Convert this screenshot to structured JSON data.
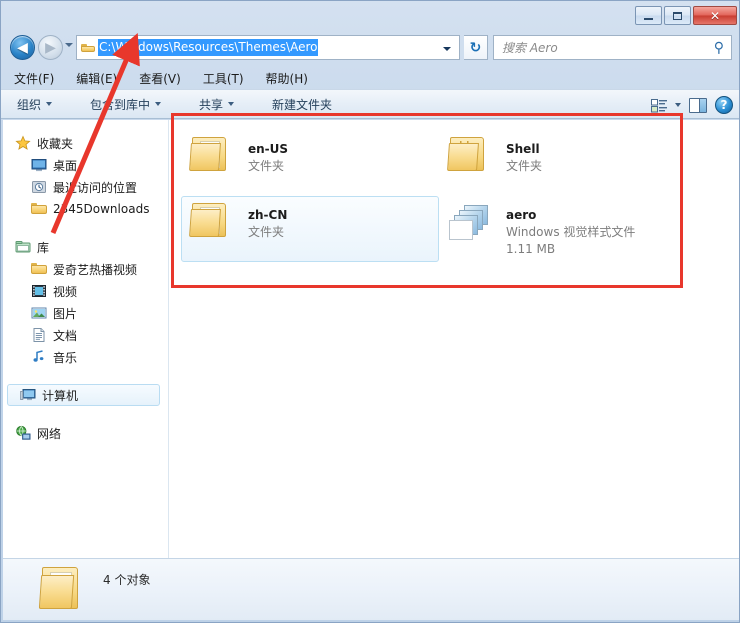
{
  "window": {
    "buttons": {
      "minimize_label": "–",
      "maximize_label": "",
      "close_label": "✕"
    }
  },
  "address_bar": {
    "back_glyph": "◀",
    "forward_glyph": "▶",
    "path": "C:\\Windows\\Resources\\Themes\\Aero",
    "refresh_glyph": "↻",
    "search_placeholder": "搜索 Aero",
    "search_icon_glyph": "⚲"
  },
  "menu": {
    "items": [
      {
        "label": "文件(F)"
      },
      {
        "label": "编辑(E)"
      },
      {
        "label": "查看(V)"
      },
      {
        "label": "工具(T)"
      },
      {
        "label": "帮助(H)"
      }
    ]
  },
  "toolbar": {
    "items": [
      {
        "label": "组织",
        "caret": true
      },
      {
        "label": "包含到库中",
        "caret": true
      },
      {
        "label": "共享",
        "caret": true
      },
      {
        "label": "新建文件夹",
        "caret": false
      }
    ],
    "help_label": "?"
  },
  "sidebar": {
    "groups": [
      {
        "header": {
          "label": "收藏夹",
          "icon": "star-icon"
        },
        "items": [
          {
            "label": "桌面",
            "icon": "desktop-icon"
          },
          {
            "label": "最近访问的位置",
            "icon": "recent-places-icon"
          },
          {
            "label": "2345Downloads",
            "icon": "folder-icon"
          }
        ]
      },
      {
        "header": {
          "label": "库",
          "icon": "library-icon"
        },
        "items": [
          {
            "label": "爱奇艺热播视频",
            "icon": "folder-icon"
          },
          {
            "label": "视频",
            "icon": "video-icon"
          },
          {
            "label": "图片",
            "icon": "pictures-icon"
          },
          {
            "label": "文档",
            "icon": "documents-icon"
          },
          {
            "label": "音乐",
            "icon": "music-icon"
          }
        ]
      },
      {
        "header": {
          "label": "计算机",
          "icon": "computer-icon",
          "hovered": true
        },
        "items": []
      },
      {
        "header": {
          "label": "网络",
          "icon": "network-icon"
        },
        "items": []
      }
    ]
  },
  "files": [
    {
      "name": "en-US",
      "type": "文件夹",
      "size": "",
      "icon": "folder-icon",
      "hovered": false
    },
    {
      "name": "Shell",
      "type": "文件夹",
      "size": "",
      "icon": "folder-multi-icon",
      "hovered": false
    },
    {
      "name": "zh-CN",
      "type": "文件夹",
      "size": "",
      "icon": "folder-icon",
      "hovered": true
    },
    {
      "name": "aero",
      "type": "Windows 视觉样式文件",
      "size": "1.11 MB",
      "icon": "theme-file-icon",
      "hovered": false
    }
  ],
  "status_bar": {
    "text": "4 个对象",
    "icon": "folder-icon"
  },
  "annotations": {
    "highlight_color": "#e8372c",
    "rectangle_label": "file-list-highlight",
    "arrow_label": "address-bar-pointer"
  }
}
